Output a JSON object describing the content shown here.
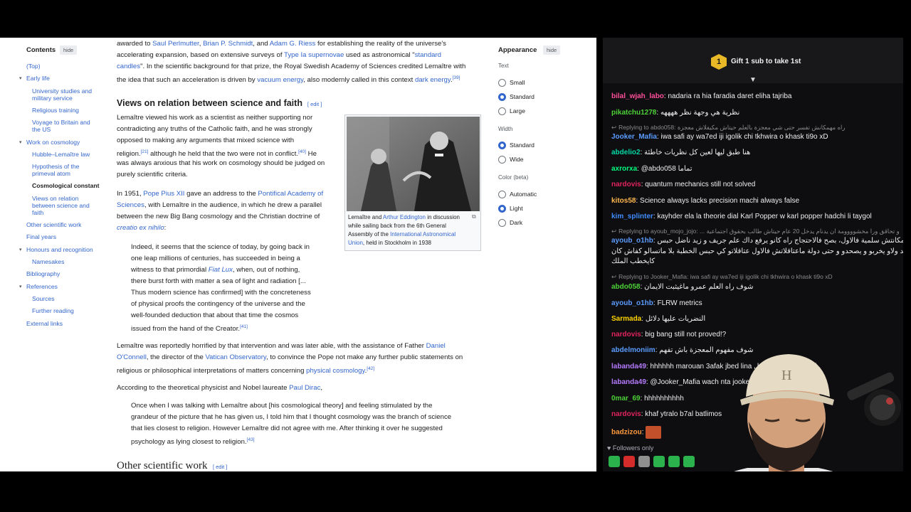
{
  "toc": {
    "title": "Contents",
    "hide": "hide",
    "items": [
      {
        "label": "(Top)"
      },
      {
        "label": "Early life"
      },
      {
        "label": "University studies and"
      },
      {
        "label": "military service"
      },
      {
        "label": "Religious training"
      },
      {
        "label": "Voyage to Britain and"
      },
      {
        "label": "the US"
      },
      {
        "label": "Work on cosmology"
      },
      {
        "label": "Hubble–Lemaître law"
      },
      {
        "label": "Hypothesis of the"
      },
      {
        "label": "primeval atom"
      },
      {
        "label": "Cosmological constant"
      },
      {
        "label": "Views on relation"
      },
      {
        "label": "between science and"
      },
      {
        "label": "faith"
      },
      {
        "label": "Other scientific work"
      },
      {
        "label": "Final years"
      },
      {
        "label": "Honours and recognition"
      },
      {
        "label": "Namesakes"
      },
      {
        "label": "Bibliography"
      },
      {
        "label": "References"
      },
      {
        "label": "Sources"
      },
      {
        "label": "Further reading"
      },
      {
        "label": "External links"
      }
    ]
  },
  "article": {
    "intro": [
      [
        "awarded to ",
        "Saul Perlmutter",
        ", ",
        "Brian P. Schmidt",
        ", and ",
        "Adam G. Riess",
        " for establishing the reality of the universe's"
      ],
      [
        "accelerating expansion, based on extensive surveys of ",
        "Type Ia supernovae",
        " used as astronomical \"",
        "standard",
        ""
      ],
      [
        "candles",
        "\". In the scientific background for that prize, the Royal Swedish Academy of Sciences credited Lemaître with"
      ],
      [
        "the idea that such an acceleration is driven by ",
        "vacuum energy",
        ", also modernly called in this context ",
        "dark energy",
        ".",
        "[39]"
      ]
    ],
    "heading1": "Views on relation between science and faith",
    "edit": "[ edit ]",
    "p1": [
      "Lemaître viewed his work as a scientist as neither supporting nor",
      "contradicting any truths of the Catholic faith, and he was strongly",
      "opposed to making any arguments that mixed science with",
      "religion.",
      "[21]",
      " although he held that the two were not in conflict.",
      "[40]",
      " He",
      "was always anxious that his work on cosmology should be judged on",
      "purely scientific criteria."
    ],
    "p2": [
      "In 1951, ",
      "Pope Pius XII",
      " gave an address to the ",
      "Pontifical Academy of",
      "Sciences",
      ", with Lemaître in the audience, in which he drew a parallel",
      "between the new Big Bang cosmology and the Christian doctrine of",
      "creatio ex nihilo",
      ":"
    ],
    "quote1": [
      "Indeed, it seems that the science of today, by going back in",
      "one leap millions of centuries, has succeeded in being a",
      "witness to that primordial ",
      "Fiat Lux",
      ", when, out of nothing,",
      "there burst forth with matter a sea of light and radiation [...",
      "Thus modern science has confirmed] with the concreteness",
      "of physical proofs the contingency of the universe and the",
      "well-founded deduction that about that time the cosmos",
      "issued from the hand of the Creator.",
      "[41]"
    ],
    "p3": [
      "Lemaître was reportedly horrified by that intervention and was later able, with the assistance of Father ",
      "Daniel",
      "O'Connell",
      ", the director of the ",
      "Vatican Observatory",
      ", to convince the Pope not make any further public statements on",
      "religious or philosophical interpretations of matters concerning ",
      "physical cosmology",
      ".",
      "[42]"
    ],
    "p4": [
      "According to the theoretical physicist and Nobel laureate ",
      "Paul Dirac",
      ","
    ],
    "quote2": [
      "Once when I was talking with Lemaître about [his cosmological theory] and feeling stimulated by the",
      "grandeur of the picture that he has given us, I told him that I thought cosmology was the branch of science",
      "that lies closest to religion. However Lemaître did not agree with me. After thinking it over he suggested",
      "psychology as lying closest to religion.",
      "[43]"
    ],
    "heading2": "Other scientific work",
    "edit2": "[ edit ]",
    "caption": [
      "Lemaître and ",
      "Arthur Eddington",
      " in discussion",
      "while sailing back from the 6th General",
      "Assembly of the ",
      "International Astronomical",
      "Union",
      ", held in Stockholm in 1938"
    ]
  },
  "appearance": {
    "title": "Appearance",
    "hide": "hide",
    "text_label": "Text",
    "text_options": [
      "Small",
      "Standard",
      "Large"
    ],
    "text_selected": "Standard",
    "width_label": "Width",
    "width_options": [
      "Standard",
      "Wide"
    ],
    "width_selected": "Standard",
    "color_label": "Color (beta)",
    "color_options": [
      "Automatic",
      "Light",
      "Dark"
    ],
    "color_selected": "Light"
  },
  "chat": {
    "gift_badge": "1",
    "gift_text": "Gift 1 sub to take 1st",
    "messages": [
      {
        "user": "bilal_wjah_labo",
        "color": "#ff4f9a",
        "text": "nadaria ra hia faradia daret eliha tajriba"
      },
      {
        "user": "pikatchu1278",
        "color": "#4cd137",
        "text": "نظرية هي وجهة نظر ههههه"
      },
      {
        "reply": "Replying to abdo058: راه مهمكانش تفسر حتى شي معجزة بالعلم حيتاش مكيفلاش معجزة"
      },
      {
        "user": "Jooker_Mafia",
        "color": "#5b9cff",
        "text": "iwa safi ay wa7ed iji igolik chi tkhwira o khask ti9o xD"
      },
      {
        "user": "abdelio2",
        "color": "#00d8a7",
        "text": "هنا طبق ليها لعين كل نظريات خاطئة"
      },
      {
        "user": "axrorxa",
        "color": "#00ff7f",
        "text": "@abdo058 تماما"
      },
      {
        "user": "nardovis",
        "color": "#e0245e",
        "text": "quantum mechanics still not solved"
      },
      {
        "user": "kitos58",
        "color": "#ffb84d",
        "text": "Science always lacks precision machi always false"
      },
      {
        "user": "kim_splinter",
        "color": "#3f8cff",
        "text": "kayhder ela la theorie dial Karl Popper w karl popper hadchi li taygol"
      },
      {
        "reply": "Replying to ayoub_mojo_jojo: ... و تحاقق ورا مخشوووومة ان يدنام يدخل 20 عام حيتاش طالب بحقوق اجتماعية"
      },
      {
        "user": "ayoub_o1hb",
        "color": "#5b9cff",
        "text": "سلط مافلاتش مكانتش سلمية فالاول، بصح فالاحتجاج راه كانو يرفع داك علم جريف و زيد ناضل حبس"
      },
      {
        "line": "الخطبة و زيد ولاو يخربو و يصحدو و حتى دولة ماعتاقلاتش فالاول عتاقلاتو كي حبس الخطبة بلا ماتسالو كفاش كان"
      },
      {
        "line": "كايخطب الملك"
      },
      {
        "reply": "Replying to Jooker_Mafia: iwa safi ay wa7ed iji igolik chi tkhwira o khask ti9o xD"
      },
      {
        "user": "abdo058",
        "color": "#4cd137",
        "text": "شوف راه العلم عمرو ماغيثبت الايمان"
      },
      {
        "user": "ayoub_o1hb",
        "color": "#5b9cff",
        "text": "FLRW metrics"
      },
      {
        "user": "Sarmada",
        "color": "#ffd400",
        "text": "النضريات عليها دلائل"
      },
      {
        "user": "nardovis",
        "color": "#e0245e",
        "text": "big bang still not proved!?"
      },
      {
        "user": "abdelmoniim",
        "color": "#5b9cff",
        "text": "شوف مفهوم المعجزة باش تفهم"
      },
      {
        "user": "labanda49",
        "color": "#b57bff",
        "text": "hhhhhh marouan 3afak jbed lina              الشمس ديال الرسول"
      },
      {
        "user": "labanda49",
        "color": "#b57bff",
        "text": "@Jooker_Mafia wach nta jooke                          d agadir ??"
      },
      {
        "user": "0mar_69",
        "color": "#4cd137",
        "text": "hhhhhhhhhh"
      },
      {
        "user": "nardovis",
        "color": "#e0245e",
        "text": "khaf ytralo b7al batlimos"
      },
      {
        "user": "badzizou",
        "color": "#ff9a3d",
        "text": "",
        "emote": true
      }
    ],
    "followers": "Followers only"
  }
}
